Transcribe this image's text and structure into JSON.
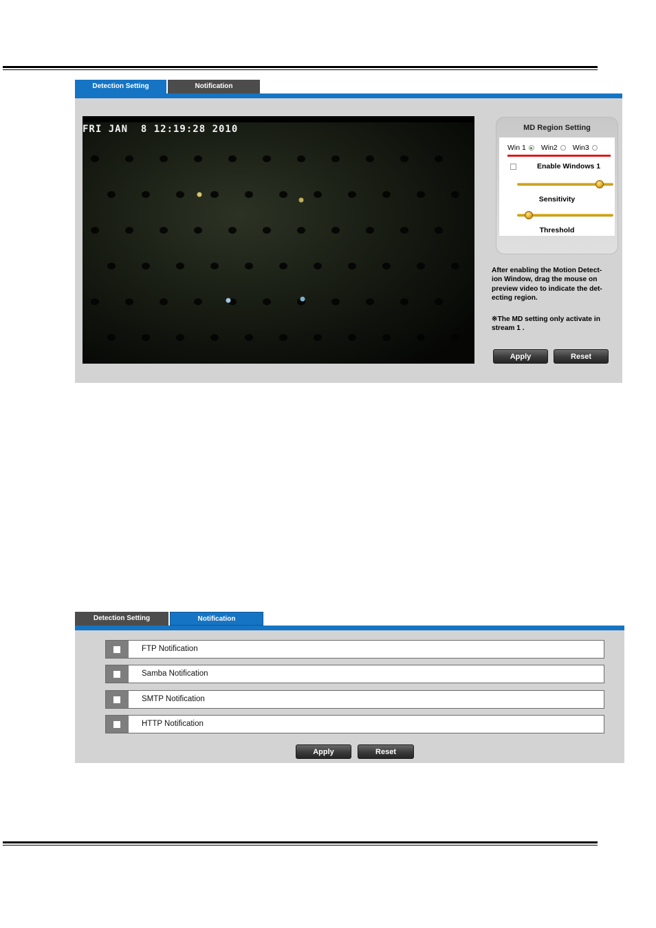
{
  "top_section": {
    "tabs": [
      {
        "label": "Detection Setting",
        "active": true
      },
      {
        "label": "Notification",
        "active": false
      }
    ],
    "video": {
      "timestamp": "FRI JAN  8 12:19:28 2010"
    },
    "md_region": {
      "title": "MD Region Setting",
      "windows": [
        {
          "label": "Win 1",
          "selected": true
        },
        {
          "label": "Win2",
          "selected": false
        },
        {
          "label": "Win3",
          "selected": false
        }
      ],
      "enable_label": "Enable Windows 1",
      "sensitivity_label": "Sensitivity",
      "sensitivity_level": 0.86,
      "threshold_label": "Threshold",
      "threshold_level": 0.12
    },
    "instructions": [
      "After enabling the Motion Detect-",
      "ion Window, drag the mouse on",
      "preview video to indicate the det-",
      "ecting region."
    ],
    "note": [
      "※The MD setting only activate in",
      "stream 1 ."
    ],
    "apply_label": "Apply",
    "reset_label": "Reset"
  },
  "bottom_section": {
    "tabs": [
      {
        "label": "Detection Setting",
        "active": false
      },
      {
        "label": "Notification",
        "active": true
      }
    ],
    "notifications": [
      {
        "label": "FTP Notification"
      },
      {
        "label": "Samba Notification"
      },
      {
        "label": "SMTP Notification"
      },
      {
        "label": "HTTP Notification"
      }
    ],
    "apply_label": "Apply",
    "reset_label": "Reset"
  },
  "colors": {
    "tab_active": "#1574c4",
    "tab_inactive": "#4c4c4c",
    "panel_bg": "#d3d3d3",
    "accent_red": "#e01818"
  }
}
